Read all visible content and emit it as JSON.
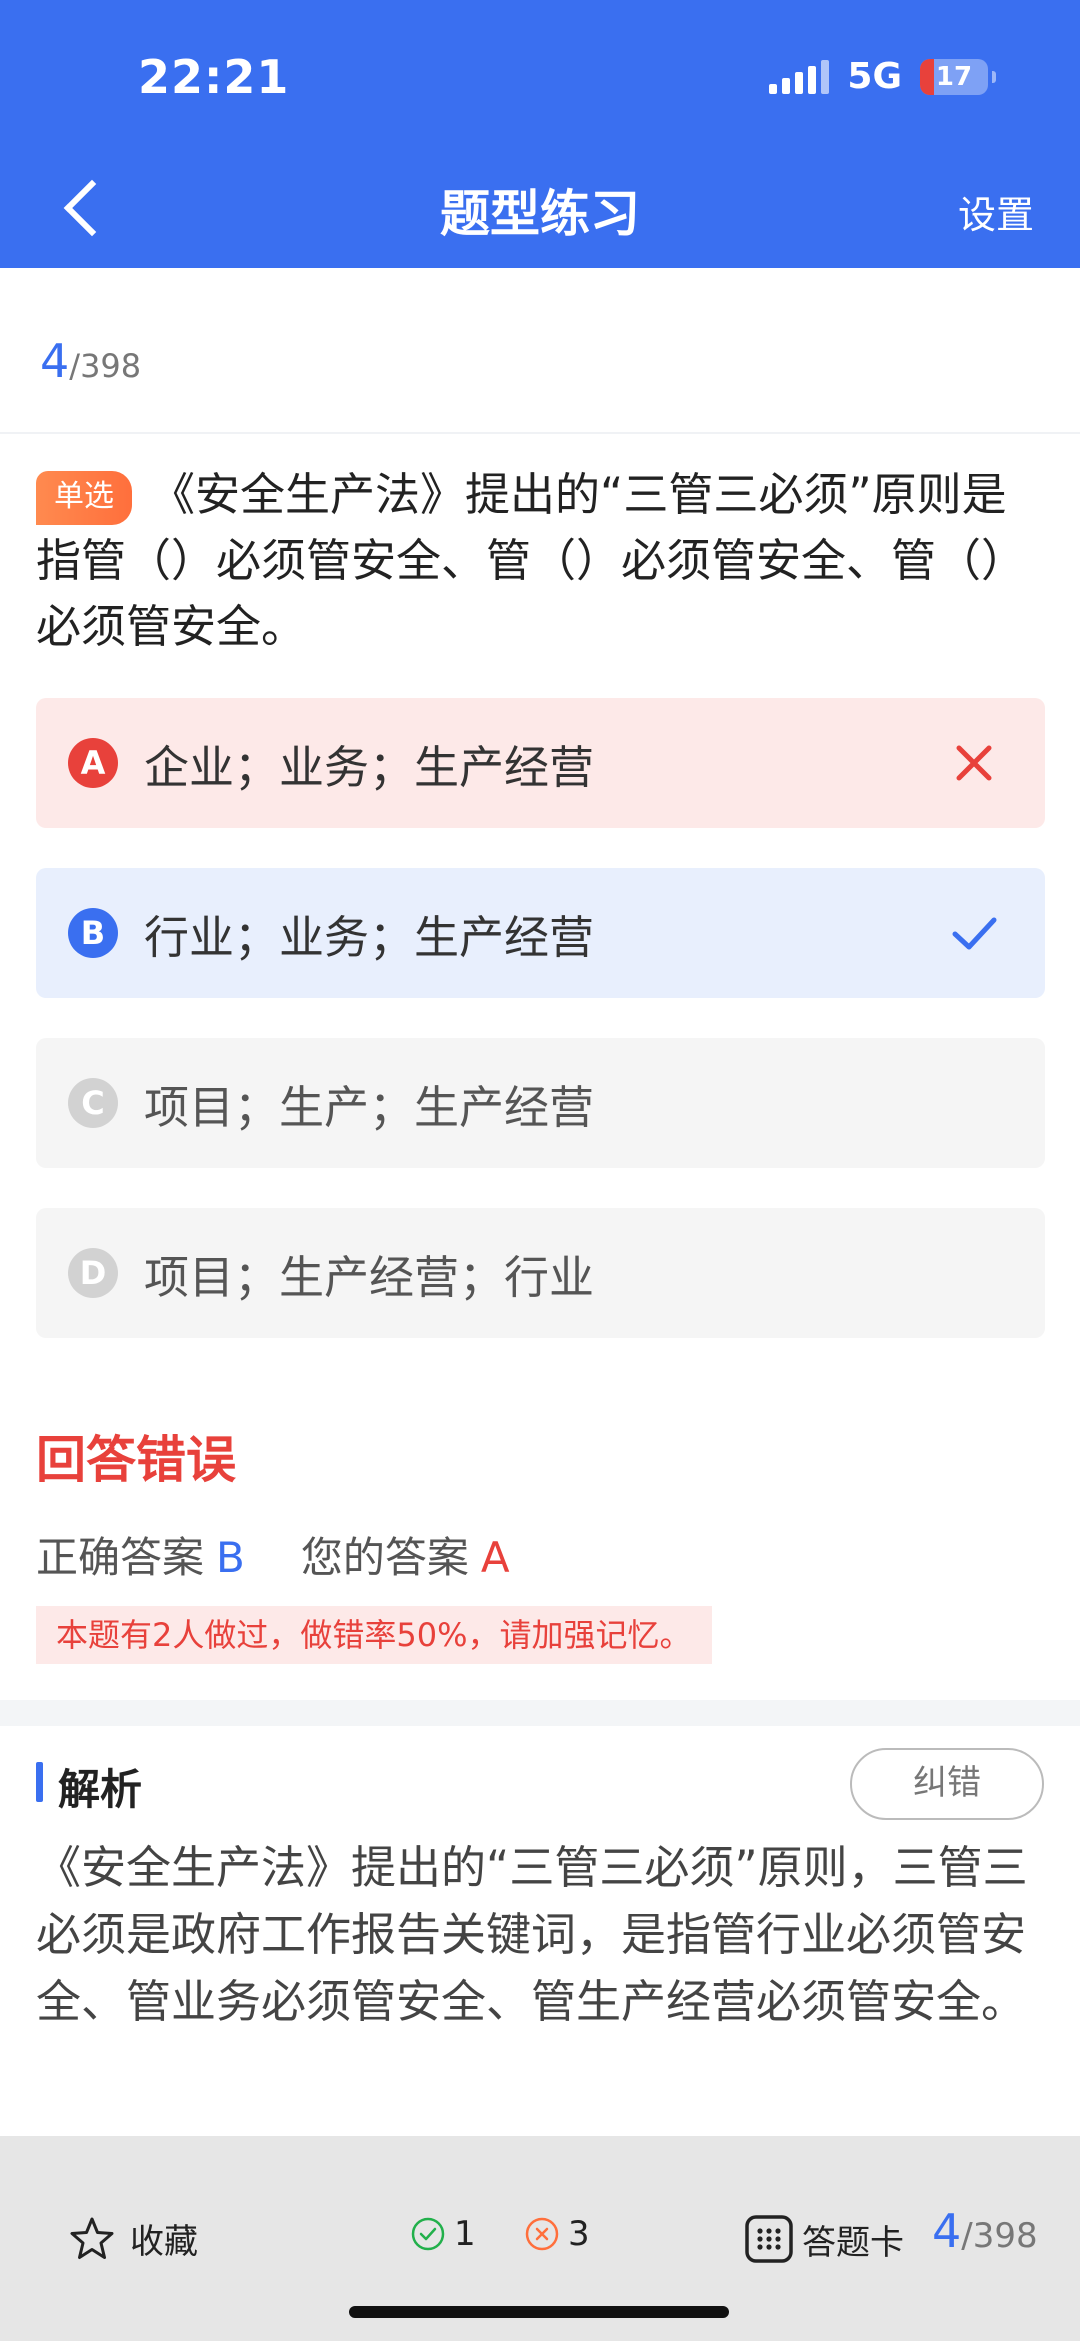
{
  "status": {
    "time": "22:21",
    "network": "5G",
    "battery": "17"
  },
  "nav": {
    "title": "题型练习",
    "settings": "设置"
  },
  "progress": {
    "current": "4",
    "total": "/398"
  },
  "question": {
    "type_tag": "单选",
    "text": "《安全生产法》提出的“三管三必须”原则是指管（）必须管安全、管（）必须管安全、管（）必须管安全。"
  },
  "options": [
    {
      "letter": "A",
      "text": "企业；业务；生产经营",
      "state": "wrong"
    },
    {
      "letter": "B",
      "text": "行业；业务；生产经营",
      "state": "correct"
    },
    {
      "letter": "C",
      "text": "项目；生产；生产经营",
      "state": "none"
    },
    {
      "letter": "D",
      "text": "项目；生产经营；行业",
      "state": "none"
    }
  ],
  "result": {
    "title": "回答错误",
    "correct_label": "正确答案",
    "correct_value": "B",
    "yours_label": "您的答案",
    "yours_value": "A",
    "tip": "本题有2人做过，做错率50%，请加强记忆。"
  },
  "analysis": {
    "title": "解析",
    "report_button": "纠错",
    "text": "《安全生产法》提出的“三管三必须”原则，三管三必须是政府工作报告关键词，是指管行业必须管安全、管业务必须管安全、管生产经营必须管安全。"
  },
  "bottom": {
    "favorite": "收藏",
    "right_count": "1",
    "wrong_count": "3",
    "card": "答题卡",
    "progress_current": "4",
    "progress_total": "/398"
  },
  "colors": {
    "primary": "#3a6ff0",
    "error": "#e8413b",
    "tag": "#ff7a45"
  }
}
